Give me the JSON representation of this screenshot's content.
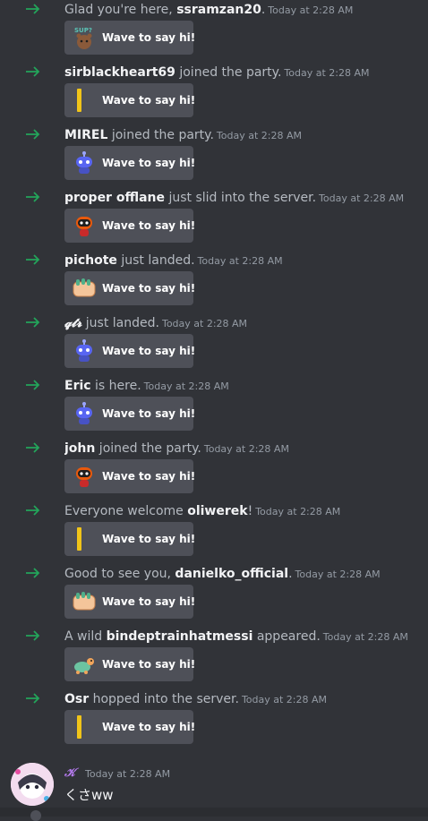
{
  "wave_label": "Wave to say hi!",
  "colors": {
    "background": "#313338",
    "arrow": "#23a55a",
    "button": "#4e5058",
    "author": "#b77cf2"
  },
  "joins": [
    {
      "pre": "Glad you're here, ",
      "name": "ssramzan20",
      "post": ".",
      "time": "Today at 2:28 AM",
      "sticker": "sup-bear-sticker"
    },
    {
      "pre": "",
      "name": "sirblackheart69",
      "post": " joined the party.",
      "time": "Today at 2:28 AM",
      "sticker": "yellow-bar-sticker"
    },
    {
      "pre": "",
      "name": "MIREL",
      "post": " joined the party.",
      "time": "Today at 2:28 AM",
      "sticker": "blue-robot-sticker"
    },
    {
      "pre": "",
      "name": "proper offlane",
      "post": " just slid into the server.",
      "time": "Today at 2:28 AM",
      "sticker": "red-robot-sticker"
    },
    {
      "pre": "",
      "name": "pichote",
      "post": " just landed.",
      "time": "Today at 2:28 AM",
      "sticker": "waving-hand-sticker"
    },
    {
      "pre": "",
      "name": "𝓺𝓽𝓻",
      "post": " just landed.",
      "time": "Today at 2:28 AM",
      "sticker": "blue-robot-sticker"
    },
    {
      "pre": "",
      "name": "Eric",
      "post": " is here.",
      "time": "Today at 2:28 AM",
      "sticker": "blue-robot-sticker"
    },
    {
      "pre": "",
      "name": "john",
      "post": " joined the party.",
      "time": "Today at 2:28 AM",
      "sticker": "red-robot-sticker"
    },
    {
      "pre": "Everyone welcome ",
      "name": "oliwerek",
      "post": "!",
      "time": "Today at 2:28 AM",
      "sticker": "yellow-bar-sticker"
    },
    {
      "pre": "Good to see you, ",
      "name": "danielko_official",
      "post": ".",
      "time": "Today at 2:28 AM",
      "sticker": "waving-hand-sticker"
    },
    {
      "pre": "A wild ",
      "name": "bindeptrainhatmessi",
      "post": " appeared.",
      "time": "Today at 2:28 AM",
      "sticker": "turtle-sticker"
    },
    {
      "pre": "",
      "name": "Osr",
      "post": " hopped into the server.",
      "time": "Today at 2:28 AM",
      "sticker": "yellow-bar-sticker"
    }
  ],
  "message": {
    "author": "𝒦",
    "time": "Today at 2:28 AM",
    "text": "くさww"
  }
}
